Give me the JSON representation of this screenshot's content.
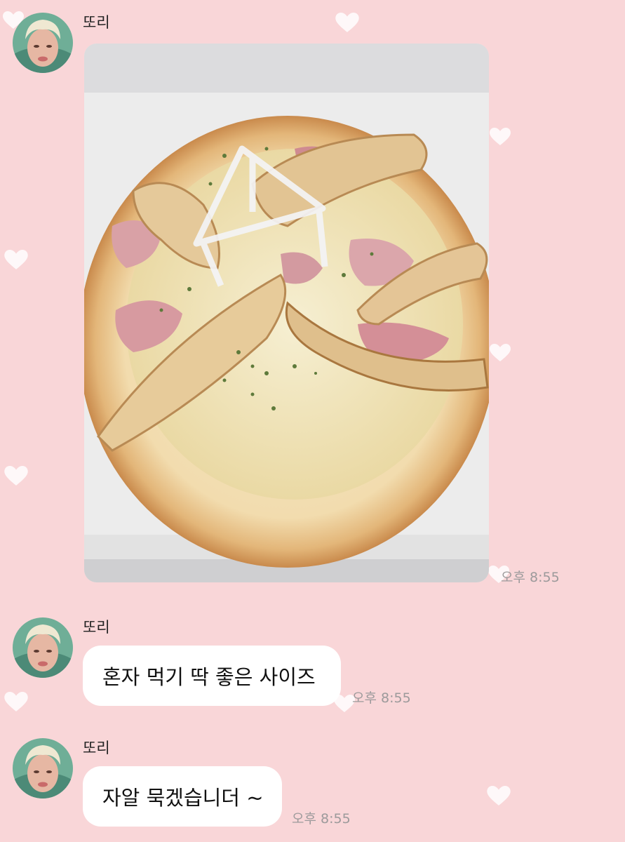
{
  "messages": [
    {
      "sender": "또리",
      "type": "image",
      "image_alt": "pizza-photo",
      "time": "오후 8:55"
    },
    {
      "sender": "또리",
      "type": "text",
      "text": "혼자 먹기 딱 좋은 사이즈",
      "time": "오후 8:55"
    },
    {
      "sender": "또리",
      "type": "text",
      "text": "자알 묵겠습니더 ~",
      "time": "오후 8:55"
    }
  ],
  "colors": {
    "background": "#f9d6d8",
    "bubble": "#ffffff",
    "timestamp": "#9c9a9b",
    "heart": "#ffffff"
  },
  "icons": {
    "decoration": "heart-icon",
    "profile": "avatar"
  }
}
